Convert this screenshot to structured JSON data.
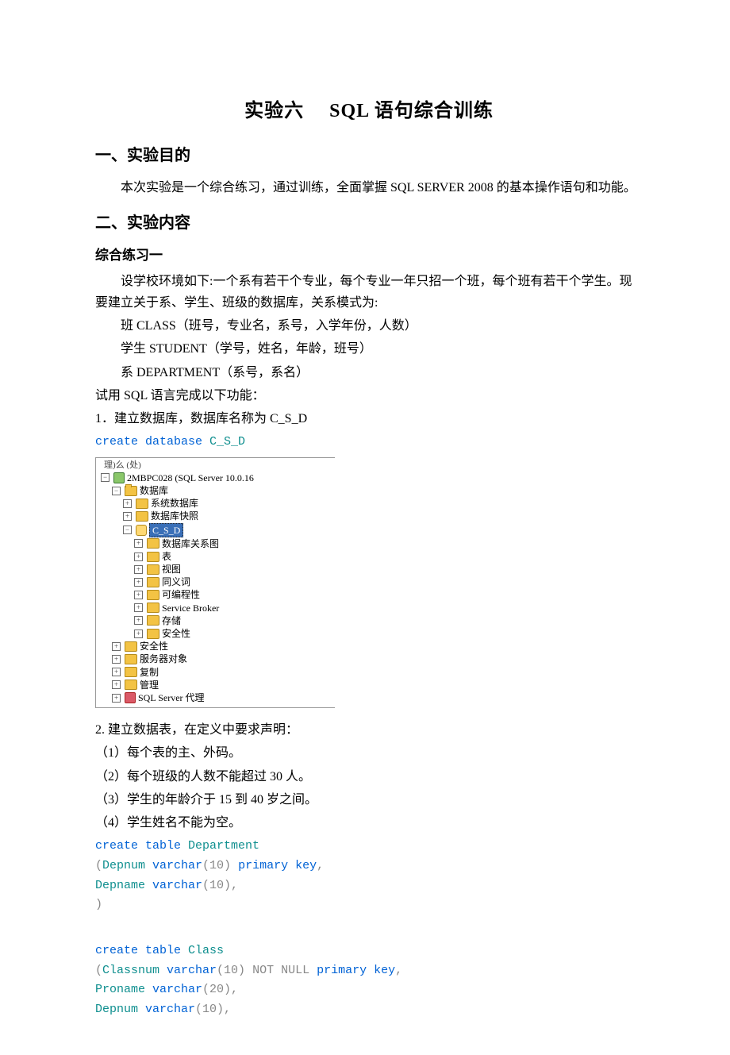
{
  "title": "实验六　 SQL 语句综合训练",
  "section1_heading": "一、实验目的",
  "section1_para": "本次实验是一个综合练习，通过训练，全面掌握 SQL SERVER 2008 的基本操作语句和功能。",
  "section2_heading": "二、实验内容",
  "practice1_heading": "综合练习一",
  "p1": "设学校环境如下:一个系有若干个专业，每个专业一年只招一个班，每个班有若干个学生。现要建立关于系、学生、班级的数据库，关系模式为:",
  "schema_class": "班 CLASS（班号，专业名，系号，入学年份，人数）",
  "schema_student": "学生 STUDENT（学号，姓名，年龄，班号）",
  "schema_department": "系 DEPARTMENT（系号，系名）",
  "task_intro": "试用 SQL 语言完成以下功能：",
  "task1": "1．建立数据库，数据库名称为 C_S_D",
  "code1": {
    "kw": "create database",
    "name": " C_S_D"
  },
  "tree": {
    "toolbar_hint": "理)么 (处)",
    "server": "2MBPC028 (SQL Server 10.0.16",
    "databases": "数据库",
    "sysdb": "系统数据库",
    "snapshot": "数据库快照",
    "csd": "C_S_D",
    "diagram": "数据库关系图",
    "tables": "表",
    "views": "视图",
    "synonym": "同义词",
    "programmability": "可编程性",
    "service_broker": "Service Broker",
    "storage": "存储",
    "security_db": "安全性",
    "security_srv": "安全性",
    "server_objects": "服务器对象",
    "replication": "复制",
    "management": "管理",
    "agent": "SQL Server 代理"
  },
  "task2": "2. 建立数据表，在定义中要求声明：",
  "req1": "（1）每个表的主、外码。",
  "req2": "（2）每个班级的人数不能超过 30 人。",
  "req3": "（3）学生的年龄介于 15 到 40 岁之间。",
  "req4": "（4）学生姓名不能为空。",
  "code_dept": {
    "l1_kw": "create table",
    "l1_name": " Department",
    "l2_open": "(",
    "l2_col": "Depnum ",
    "l2_type": "varchar",
    "l2_args": "(10) ",
    "l2_pk": "primary key",
    "l2_end": ",",
    "l3_col": "Depname ",
    "l3_type": "varchar",
    "l3_args": "(10),",
    "l4": ")"
  },
  "code_class": {
    "l1_kw": "create table",
    "l1_name": " Class",
    "l2_open": "(",
    "l2_col": "Classnum ",
    "l2_type": "varchar",
    "l2_args": "(10) ",
    "l2_nn": "NOT NULL ",
    "l2_pk": "primary key",
    "l2_end": ",",
    "l3_col": " Proname ",
    "l3_type": "varchar",
    "l3_args": "(20),",
    "l4_col": " Depnum ",
    "l4_type": "varchar",
    "l4_args": "(10),"
  }
}
